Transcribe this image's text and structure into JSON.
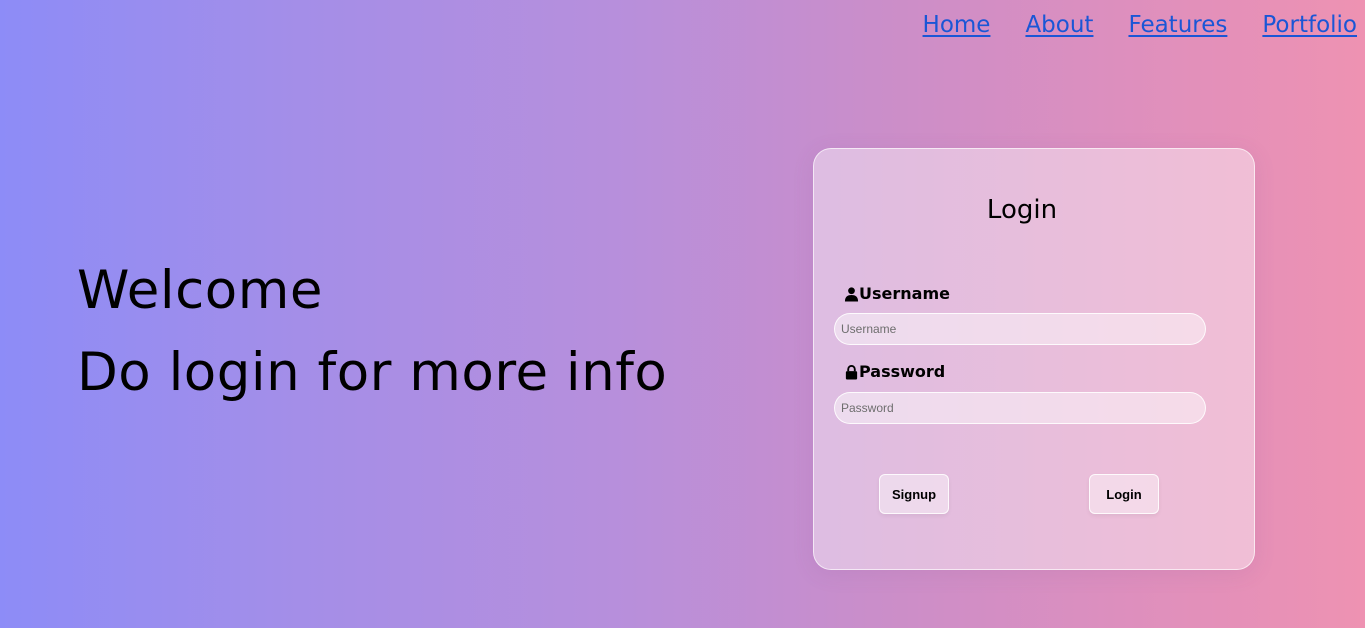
{
  "nav": {
    "items": [
      {
        "label": "Home"
      },
      {
        "label": "About"
      },
      {
        "label": "Features"
      },
      {
        "label": "Portfolio"
      }
    ],
    "link_color": "#1a56d6"
  },
  "hero": {
    "line1": "Welcome",
    "line2": "Do login for more info"
  },
  "login_card": {
    "title": "Login",
    "username": {
      "label": "Username",
      "icon": "user-icon",
      "placeholder": "Username",
      "value": ""
    },
    "password": {
      "label": "Password",
      "icon": "lock-icon",
      "placeholder": "Password",
      "value": ""
    },
    "signup_label": "Signup",
    "login_label": "Login"
  },
  "theme": {
    "gradient_start": "#8d8cf7",
    "gradient_end": "#ee92b2"
  }
}
